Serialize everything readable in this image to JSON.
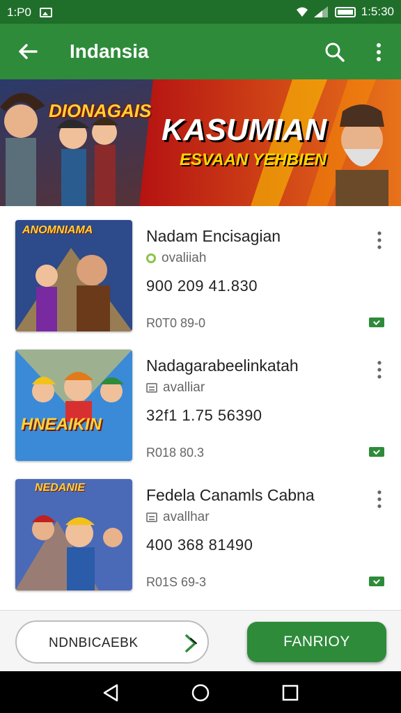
{
  "status_bar": {
    "time_left": "1:P0",
    "time_right": "1:5:30"
  },
  "app_bar": {
    "title": "Indansia"
  },
  "banner": {
    "left_logo_text": "DIONAGAIS",
    "headline": "KASUMIAN",
    "subheadline": "ESVAAN YEHBIEN",
    "accent_color": "#e2231a"
  },
  "games": [
    {
      "name": "Nadam Encisagian",
      "subtitle": "ovaliiah",
      "stats": "900  209  41.830",
      "meta": "R0T0    89-0",
      "thumb_text": "ANOMNIAMA",
      "sub_icon": "ring-icon"
    },
    {
      "name": "Nadagarabeelinkatah",
      "subtitle": "avalliar",
      "stats": "32f1  1.75  56390",
      "meta": "R018    80.3",
      "thumb_text": "HNEAIKIN",
      "sub_icon": "list-icon"
    },
    {
      "name": "Fedela Canamls Cabna",
      "subtitle": "avallhar",
      "stats": "400  368  81490",
      "meta": "R01S    69-3",
      "thumb_text": "NEDANIE",
      "sub_icon": "list-icon"
    }
  ],
  "action_bar": {
    "secondary_label": "NDNBICAEBK",
    "primary_label": "FANRIOY"
  },
  "colors": {
    "primary": "#2e8b3a",
    "primary_dark": "#1f6f2b"
  }
}
